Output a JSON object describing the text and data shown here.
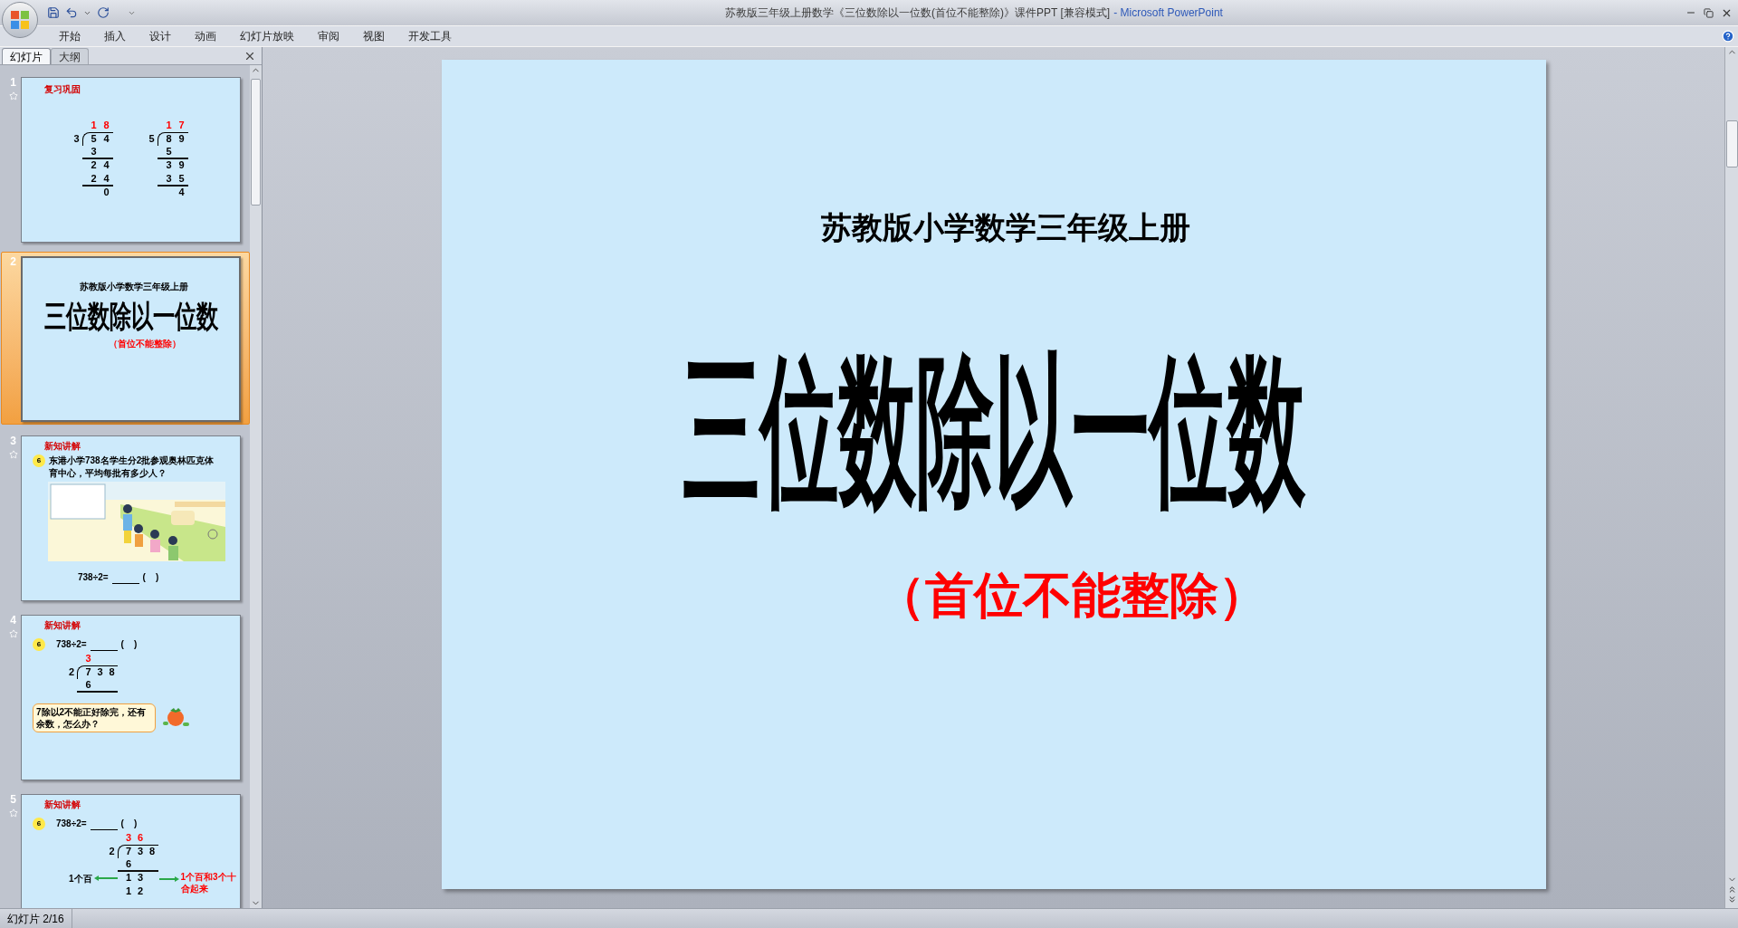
{
  "title_bar": {
    "document_title": "苏教版三年级上册数学《三位数除以一位数(首位不能整除)》课件PPT [兼容模式]",
    "app_name": "- Microsoft PowerPoint"
  },
  "menu_tabs": [
    "开始",
    "插入",
    "设计",
    "动画",
    "幻灯片放映",
    "审阅",
    "视图",
    "开发工具"
  ],
  "pane_tabs": [
    {
      "label": "幻灯片",
      "selected": true
    },
    {
      "label": "大纲",
      "selected": false
    }
  ],
  "thumbnails": [
    {
      "number": "1",
      "selected": false,
      "animated": true,
      "kind": "review",
      "heading": "复习巩固",
      "divisions": [
        {
          "divisor": "3",
          "quotient": [
            "1",
            "8"
          ],
          "dividend": [
            "5",
            "4"
          ],
          "steps": [
            {
              "digits": [
                "3"
              ],
              "kind": "leading",
              "rule": true
            },
            {
              "digits": [
                "2",
                "4"
              ],
              "kind": "leading",
              "rule": false
            },
            {
              "digits": [
                "2",
                "4"
              ],
              "kind": "leading",
              "rule": true
            },
            {
              "digits": [
                "0"
              ],
              "kind": "trailing",
              "rule": false
            }
          ]
        },
        {
          "divisor": "5",
          "quotient": [
            "1",
            "7"
          ],
          "dividend": [
            "8",
            "9"
          ],
          "steps": [
            {
              "digits": [
                "5"
              ],
              "kind": "leading",
              "rule": true
            },
            {
              "digits": [
                "3",
                "9"
              ],
              "kind": "leading",
              "rule": false
            },
            {
              "digits": [
                "3",
                "5"
              ],
              "kind": "leading",
              "rule": true
            },
            {
              "digits": [
                "4"
              ],
              "kind": "trailing",
              "rule": false
            }
          ]
        }
      ]
    },
    {
      "number": "2",
      "selected": true,
      "animated": false,
      "kind": "title",
      "subtitle": "苏教版小学数学三年级上册",
      "title": "三位数除以一位数",
      "note": "（首位不能整除）"
    },
    {
      "number": "3",
      "selected": false,
      "animated": true,
      "kind": "problem",
      "heading": "新知讲解",
      "badge": "6",
      "question": "东港小学738名学生分2批参观奥林匹克体育中心，平均每批有多少人？",
      "equation": "738÷2=",
      "answer": "(    )"
    },
    {
      "number": "4",
      "selected": false,
      "animated": true,
      "kind": "division",
      "heading": "新知讲解",
      "badge": "6",
      "equation": "738÷2=",
      "answer": "(    )",
      "division": {
        "divisor": "2",
        "quotient": [
          "3"
        ],
        "dividend": [
          "7",
          "3",
          "8"
        ],
        "steps": [
          {
            "digits": [
              "6"
            ],
            "kind": "leading",
            "rule": true
          }
        ]
      },
      "bubble": "7除以2不能正好除完，还有余数，怎么办？"
    },
    {
      "number": "5",
      "selected": false,
      "animated": true,
      "kind": "division",
      "heading": "新知讲解",
      "badge": "6",
      "equation": "738÷2=",
      "answer": "(    )",
      "division": {
        "divisor": "2",
        "quotient": [
          "3",
          "6"
        ],
        "dividend": [
          "7",
          "3",
          "8"
        ],
        "steps": [
          {
            "digits": [
              "6"
            ],
            "kind": "leading",
            "rule": true
          },
          {
            "digits": [
              "1",
              "3"
            ],
            "kind": "leading",
            "rule": false
          },
          {
            "digits": [
              "1",
              "2"
            ],
            "kind": "leading",
            "rule": false
          }
        ]
      },
      "left_label": "1个百",
      "right_label": "1个百和3个十合起来"
    }
  ],
  "slide": {
    "subtitle": "苏教版小学数学三年级上册",
    "title": "三位数除以一位数",
    "note": "（首位不能整除）"
  },
  "status_bar": {
    "slide_indicator": "幻灯片 2/16"
  }
}
